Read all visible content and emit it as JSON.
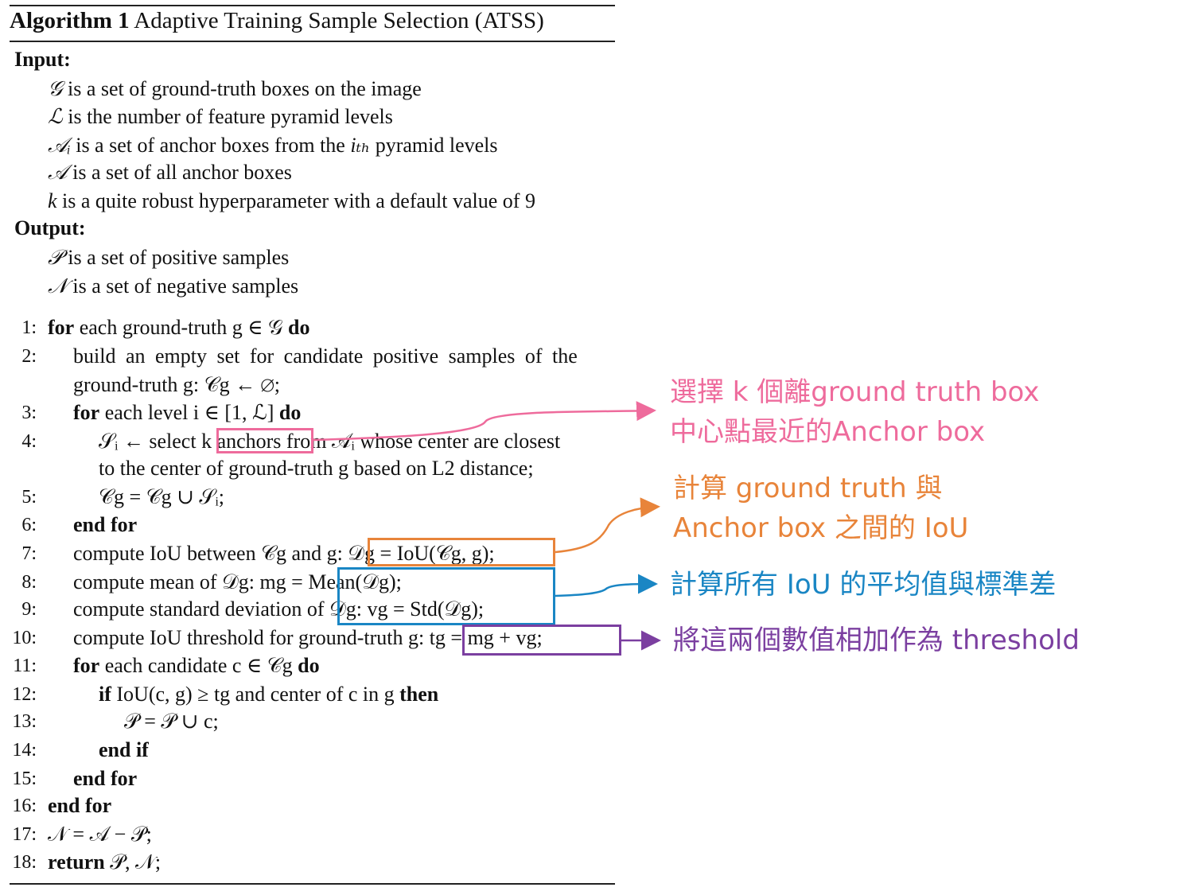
{
  "algorithm": {
    "label": "Algorithm 1",
    "title": "Adaptive Training Sample Selection (ATSS)",
    "input_header": "Input:",
    "inputs": [
      {
        "sym": "𝒢",
        "text": " is a set of ground-truth boxes on the image"
      },
      {
        "sym": "ℒ",
        "text": " is the number of feature pyramid levels"
      },
      {
        "sym": "𝒜ᵢ",
        "text": " is a set of anchor boxes from the ",
        "sym2": "iₜₕ",
        "text2": " pyramid levels"
      },
      {
        "sym": "𝒜",
        "text": " is a set of all anchor boxes"
      },
      {
        "sym": "k",
        "text": " is a quite robust hyperparameter with a default value of 9"
      }
    ],
    "output_header": "Output:",
    "outputs": [
      {
        "sym": "𝒫",
        "text": " is a set of positive samples"
      },
      {
        "sym": "𝒩",
        "text": " is a set of negative samples"
      }
    ],
    "steps": [
      {
        "n": "1:",
        "kw": "for",
        "text": " each ground-truth g ∈ 𝒢 ",
        "kw2": "do"
      },
      {
        "n": "2:",
        "kw": "",
        "text": "build an empty set for candidate positive samples of the",
        "kw2": ""
      },
      {
        "n": "",
        "kw": "",
        "text": "ground-truth g: 𝒞g ← ∅;",
        "kw2": ""
      },
      {
        "n": "3:",
        "kw": "for",
        "text": " each level i ∈ [1, ℒ] ",
        "kw2": "do"
      },
      {
        "n": "4:",
        "kw": "",
        "text": "𝒮ᵢ ←  select k anchors from 𝒜ᵢ whose center are closest",
        "kw2": ""
      },
      {
        "n": "",
        "kw": "",
        "text": "to the center of ground-truth g based on L2 distance;",
        "kw2": ""
      },
      {
        "n": "5:",
        "kw": "",
        "text": "𝒞g = 𝒞g ∪ 𝒮ᵢ;",
        "kw2": ""
      },
      {
        "n": "6:",
        "kw": "end for",
        "text": "",
        "kw2": ""
      },
      {
        "n": "7:",
        "kw": "",
        "text": "compute IoU between 𝒞g and g: 𝒟g = IoU(𝒞g, g);",
        "kw2": ""
      },
      {
        "n": "8:",
        "kw": "",
        "text": "compute mean of 𝒟g: mg = Mean(𝒟g);",
        "kw2": ""
      },
      {
        "n": "9:",
        "kw": "",
        "text": "compute standard deviation of 𝒟g: vg = Std(𝒟g);",
        "kw2": ""
      },
      {
        "n": "10:",
        "kw": "",
        "text": "compute IoU threshold for ground-truth g: tg = mg + vg;",
        "kw2": ""
      },
      {
        "n": "11:",
        "kw": "for",
        "text": " each candidate c ∈ 𝒞g ",
        "kw2": "do"
      },
      {
        "n": "12:",
        "kw": "if",
        "text": " IoU(c, g) ≥ tg and center of c in g ",
        "kw2": "then"
      },
      {
        "n": "13:",
        "kw": "",
        "text": "𝒫 = 𝒫 ∪ c;",
        "kw2": ""
      },
      {
        "n": "14:",
        "kw": "end if",
        "text": "",
        "kw2": ""
      },
      {
        "n": "15:",
        "kw": "end for",
        "text": "",
        "kw2": ""
      },
      {
        "n": "16:",
        "kw": "end for",
        "text": "",
        "kw2": ""
      },
      {
        "n": "17:",
        "kw": "",
        "text": "𝒩 = 𝒜 − 𝒫;",
        "kw2": ""
      },
      {
        "n": "18:",
        "kw": "return",
        "text": " 𝒫, 𝒩;",
        "kw2": ""
      }
    ]
  },
  "annotations": [
    {
      "lines": [
        "選擇 k 個離ground truth box",
        "中心點最近的Anchor box"
      ],
      "color": "#ee6b9c"
    },
    {
      "lines": [
        "計算 ground truth 與",
        "Anchor box 之間的 IoU"
      ],
      "color": "#e8843a"
    },
    {
      "lines": [
        "計算所有 IoU 的平均值與標準差"
      ],
      "color": "#1a86c4"
    },
    {
      "lines": [
        "將這兩個數值相加作為 threshold"
      ],
      "color": "#7b3fa0"
    }
  ]
}
